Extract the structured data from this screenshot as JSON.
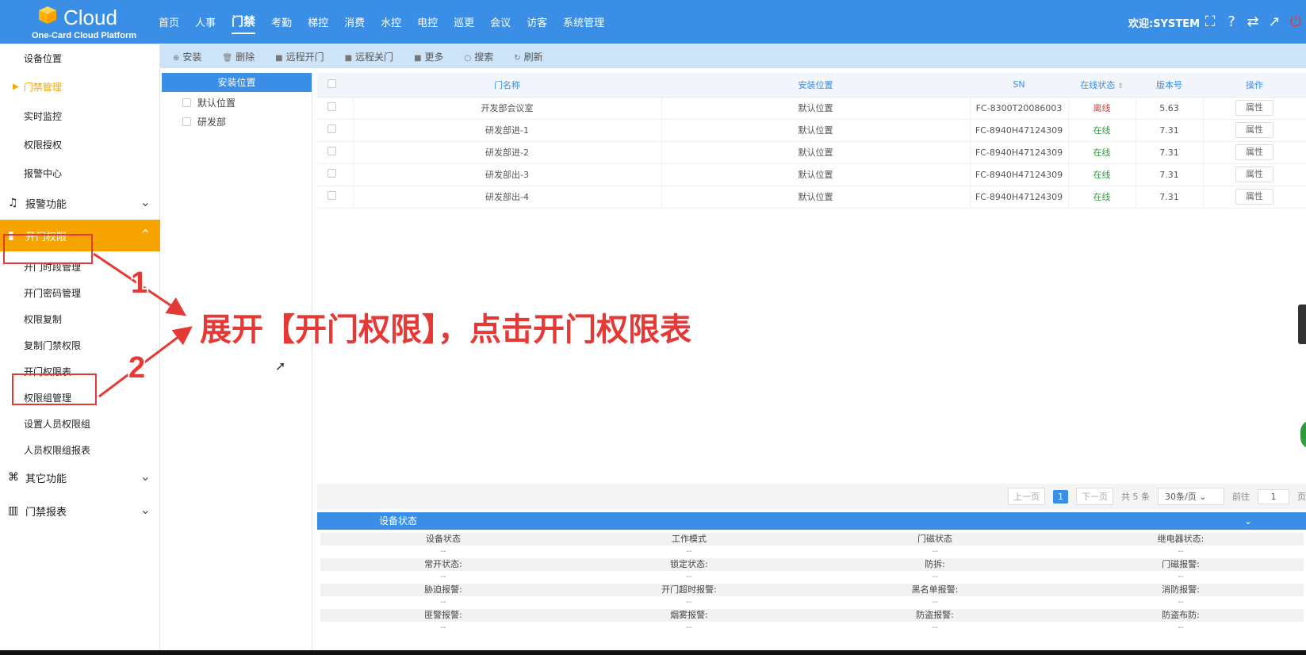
{
  "header": {
    "brand": "Cloud",
    "platform": "One-Card Cloud Platform",
    "nav": [
      "首页",
      "人事",
      "门禁",
      "考勤",
      "梯控",
      "消费",
      "水控",
      "电控",
      "巡更",
      "会议",
      "访客",
      "系统管理"
    ],
    "welcome": "欢迎:SYSTEM"
  },
  "sidebar": {
    "items": [
      "设备位置",
      "门禁管理",
      "实时监控",
      "权限授权",
      "报警中心"
    ],
    "group_alarm": "报警功能",
    "group_permission": "开门权限",
    "permission_items": [
      "开门时段管理",
      "开门密码管理",
      "权限复制",
      "复制门禁权限",
      "开门权限表",
      "权限组管理",
      "设置人员权限组",
      "人员权限组报表"
    ],
    "group_other": "其它功能",
    "group_report": "门禁报表"
  },
  "toolbar": {
    "install": "安装",
    "delete": "删除",
    "remote_open": "远程开门",
    "remote_close": "远程关门",
    "more": "更多",
    "search": "搜索",
    "refresh": "刷新"
  },
  "locations": {
    "header": "安装位置",
    "items": [
      "默认位置",
      "研发部"
    ]
  },
  "table": {
    "headers": [
      "门名称",
      "安装位置",
      "SN",
      "在线状态",
      "版本号",
      "操作"
    ],
    "attr_label": "属性",
    "rows": [
      {
        "name": "开发部会议室",
        "location": "默认位置",
        "sn": "FC-8300T20086003",
        "status": "离线",
        "version": "5.63"
      },
      {
        "name": "研发部进-1",
        "location": "默认位置",
        "sn": "FC-8940H47124309",
        "status": "在线",
        "version": "7.31"
      },
      {
        "name": "研发部进-2",
        "location": "默认位置",
        "sn": "FC-8940H47124309",
        "status": "在线",
        "version": "7.31"
      },
      {
        "name": "研发部出-3",
        "location": "默认位置",
        "sn": "FC-8940H47124309",
        "status": "在线",
        "version": "7.31"
      },
      {
        "name": "研发部出-4",
        "location": "默认位置",
        "sn": "FC-8940H47124309",
        "status": "在线",
        "version": "7.31"
      }
    ]
  },
  "pager": {
    "prev": "上一页",
    "page": "1",
    "next": "下一页",
    "total": "共 5 条",
    "per_page": "30条/页",
    "goto": "前往",
    "goto_value": "1",
    "page_suffix": "页"
  },
  "device_status": {
    "title": "设备状态",
    "rows": [
      [
        "设备状态",
        "工作模式",
        "门磁状态",
        "继电器状态:"
      ],
      [
        "常开状态:",
        "锁定状态:",
        "防拆:",
        "门磁报警:"
      ],
      [
        "胁迫报警:",
        "开门超时报警:",
        "黑名单报警:",
        "消防报警:"
      ],
      [
        "匪警报警:",
        "烟雾报警:",
        "防盗报警:",
        "防盗布防:"
      ]
    ],
    "empty_value": "--"
  },
  "annotation": {
    "num1": "1",
    "num2": "2",
    "text": "展开【开门权限】，点击开门权限表"
  },
  "colors": {
    "primary": "#3a8ee6",
    "accent": "#f7a400",
    "annotation": "#e53935",
    "online": "#2e9b3e",
    "offline": "#e53935"
  }
}
